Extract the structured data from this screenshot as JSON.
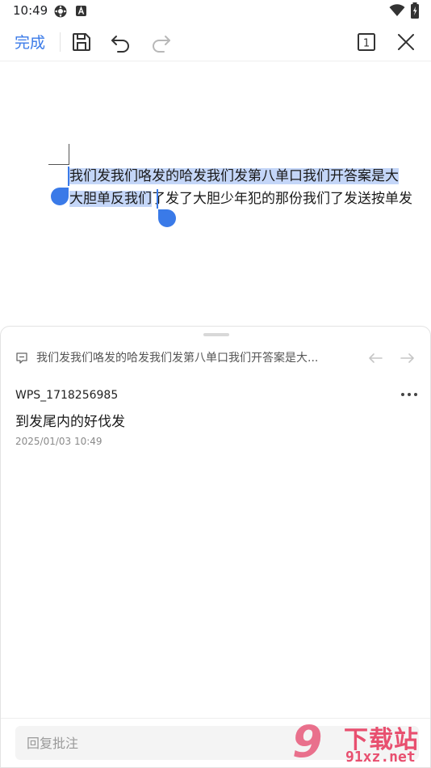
{
  "status_bar": {
    "time": "10:49",
    "icons": [
      "settings-gear-icon",
      "a-badge-icon",
      "wifi-icon",
      "battery-icon"
    ]
  },
  "toolbar": {
    "done_label": "完成",
    "page_count": "1",
    "icons": [
      "save-icon",
      "undo-icon",
      "redo-icon",
      "page-count-icon",
      "close-icon"
    ]
  },
  "document": {
    "line1_selected": "我们发我们咯发的哈发我们发第八单口我们开答案是大",
    "line2_selected": "大胆单反我们",
    "line2_rest": "了发了大胆少年犯的那份我们了发送按单发",
    "selection_color": "#c4d6f8",
    "handle_color": "#3a7ae8"
  },
  "comment_panel": {
    "quoted_text": "我们发我们咯发的哈发我们发第八单口我们开答案是大...",
    "comment": {
      "user": "WPS_1718256985",
      "body": "到发尾内的好伐发",
      "time": "2025/01/03 10:49"
    },
    "reply_placeholder": "回复批注"
  },
  "watermark": {
    "mark": "9",
    "title": "下载站",
    "url": "91xz.net"
  },
  "colors": {
    "accent": "#3a7ae8",
    "watermark": "#e84f6f"
  }
}
